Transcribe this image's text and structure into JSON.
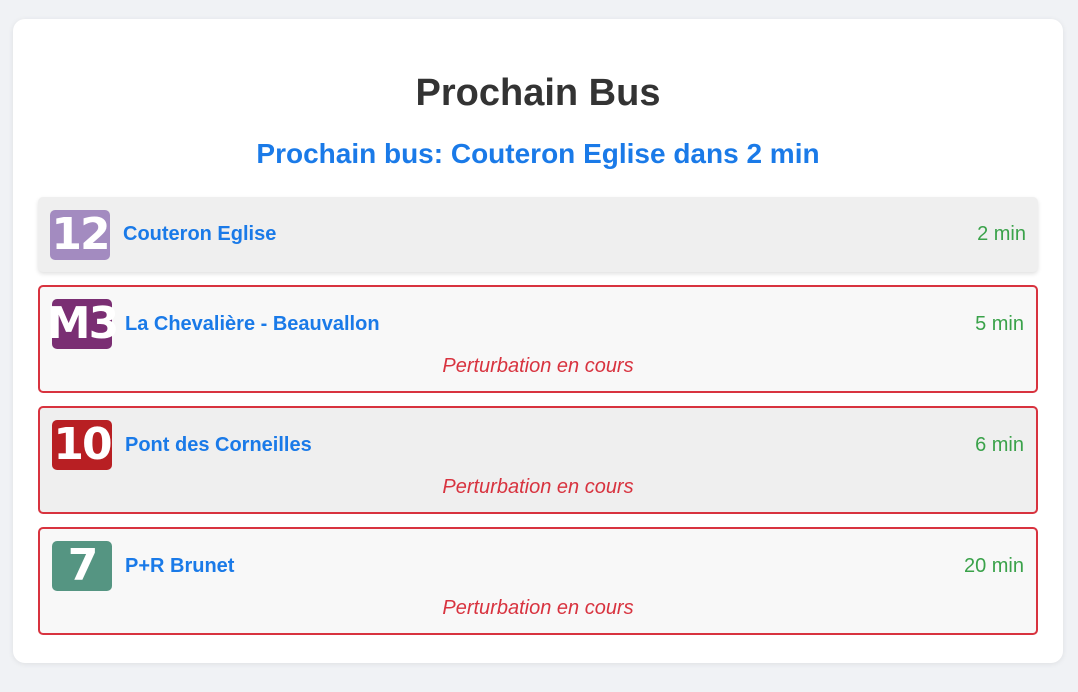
{
  "header": {
    "title": "Prochain Bus",
    "subtitle": "Prochain bus: Couteron Eglise dans 2 min"
  },
  "departures": [
    {
      "line": "12",
      "line_color": "#a38bc0",
      "stop": "Couteron Eglise",
      "eta": "2 min",
      "alert": ""
    },
    {
      "line": "M3",
      "line_color": "#7a2e73",
      "stop": "La Chevalière - Beauvallon",
      "eta": "5 min",
      "alert": "Perturbation en cours"
    },
    {
      "line": "10",
      "line_color": "#b81f23",
      "stop": "Pont des Corneilles",
      "eta": "6 min",
      "alert": "Perturbation en cours"
    },
    {
      "line": "7",
      "line_color": "#559582",
      "stop": "P+R Brunet",
      "eta": "20 min",
      "alert": "Perturbation en cours"
    }
  ],
  "colors": {
    "accent": "#1a7ae8",
    "eta": "#3aa24a",
    "alert": "#d8333f"
  }
}
